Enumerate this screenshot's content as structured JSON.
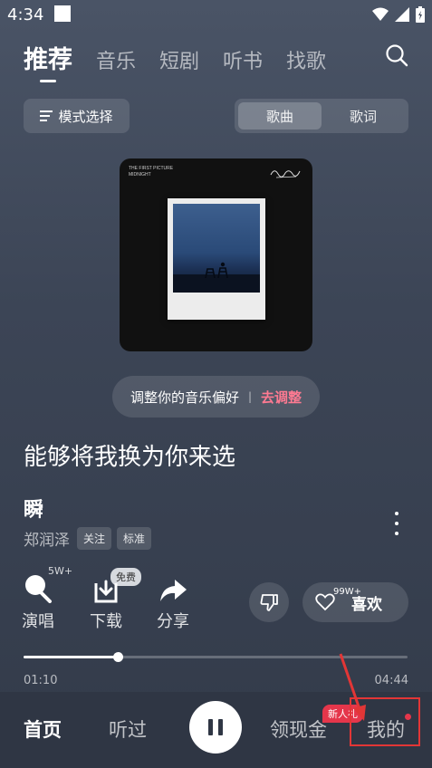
{
  "status": {
    "time": "4:34"
  },
  "nav": {
    "tabs": [
      {
        "label": "推荐"
      },
      {
        "label": "音乐"
      },
      {
        "label": "短剧"
      },
      {
        "label": "听书"
      },
      {
        "label": "找歌"
      }
    ]
  },
  "controls": {
    "mode_label": "模式选择",
    "segments": [
      {
        "label": "歌曲"
      },
      {
        "label": "歌词"
      }
    ]
  },
  "album": {
    "meta_line1": "THE FIRST PICTURE",
    "meta_line2": "MIDNIGHT"
  },
  "adjust": {
    "text": "调整你的音乐偏好",
    "separator": "|",
    "link": "去调整"
  },
  "lyric": "能够将我换为你来选",
  "song": {
    "title": "瞬",
    "artist": "郑润泽",
    "tags": [
      "关注",
      "标准"
    ]
  },
  "actions": {
    "sing_count": "5W+",
    "sing_label": "演唱",
    "free_badge": "免费",
    "download_label": "下载",
    "share_label": "分享",
    "like_count": "99W+",
    "like_label": "喜欢"
  },
  "progress": {
    "current": "01:10",
    "total": "04:44",
    "fraction": 0.246
  },
  "bottom_nav": {
    "home": "首页",
    "history": "听过",
    "cash": "领现金",
    "newbie_badge": "新人礼",
    "mine": "我的"
  },
  "colors": {
    "accent": "#ff7a92",
    "annotation": "#e23636"
  }
}
